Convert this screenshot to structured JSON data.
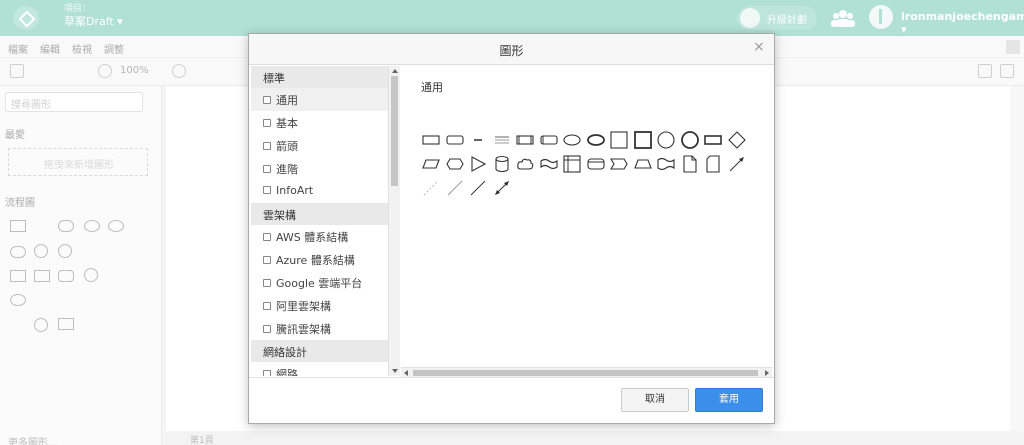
{
  "topbar": {
    "project_label": "項目：",
    "project_name": "草案Draft ▾",
    "upgrade_label": "升級計劃",
    "username": "ironmanjoechengame ▾"
  },
  "menubar": {
    "items": [
      "檔案",
      "編輯",
      "檢視",
      "調整"
    ]
  },
  "toolbar": {
    "zoom": "100%"
  },
  "left_panel": {
    "search_placeholder": "搜尋圖形",
    "section_favorites": "最愛",
    "dropzone_text": "拖曳來新增圖形",
    "section_flowchart": "流程圖",
    "more_shapes": "更多圖形..."
  },
  "pagebar": {
    "page_label": "第1頁"
  },
  "dialog": {
    "title": "圖形",
    "close": "×",
    "categories": [
      {
        "type": "group",
        "label": "標準"
      },
      {
        "type": "item",
        "label": "通用",
        "selected": true
      },
      {
        "type": "item",
        "label": "基本"
      },
      {
        "type": "item",
        "label": "箭頭"
      },
      {
        "type": "item",
        "label": "進階"
      },
      {
        "type": "item",
        "label": "InfoArt"
      },
      {
        "type": "group",
        "label": "雲架構"
      },
      {
        "type": "item",
        "label": "AWS 體系結構"
      },
      {
        "type": "item",
        "label": "Azure 體系結構"
      },
      {
        "type": "item",
        "label": "Google 雲端平台"
      },
      {
        "type": "item",
        "label": "阿里雲架構"
      },
      {
        "type": "item",
        "label": "騰訊雲架構"
      },
      {
        "type": "group",
        "label": "網絡設計"
      },
      {
        "type": "item",
        "label": "網路"
      }
    ],
    "gallery_title": "通用",
    "shapes_row1": [
      "rect",
      "rounded-rect",
      "text",
      "textblock",
      "process",
      "rounded-process",
      "ellipse",
      "ellipse-bold",
      "square",
      "square-bold",
      "circle",
      "circle-bold",
      "process-bar",
      "diamond"
    ],
    "shapes_row2": [
      "parallelogram",
      "hexagon",
      "triangle",
      "cylinder",
      "cloud",
      "tape",
      "internal-storage",
      "card",
      "step",
      "trapezoid",
      "wave",
      "document",
      "note",
      "arrow-line"
    ],
    "shapes_row3": [
      "line-dashed",
      "line-light",
      "line-diag",
      "line-double-arrow"
    ],
    "cancel_label": "取消",
    "apply_label": "套用"
  },
  "colors": {
    "topbar": "#71c6b3",
    "apply": "#3b8eea"
  }
}
